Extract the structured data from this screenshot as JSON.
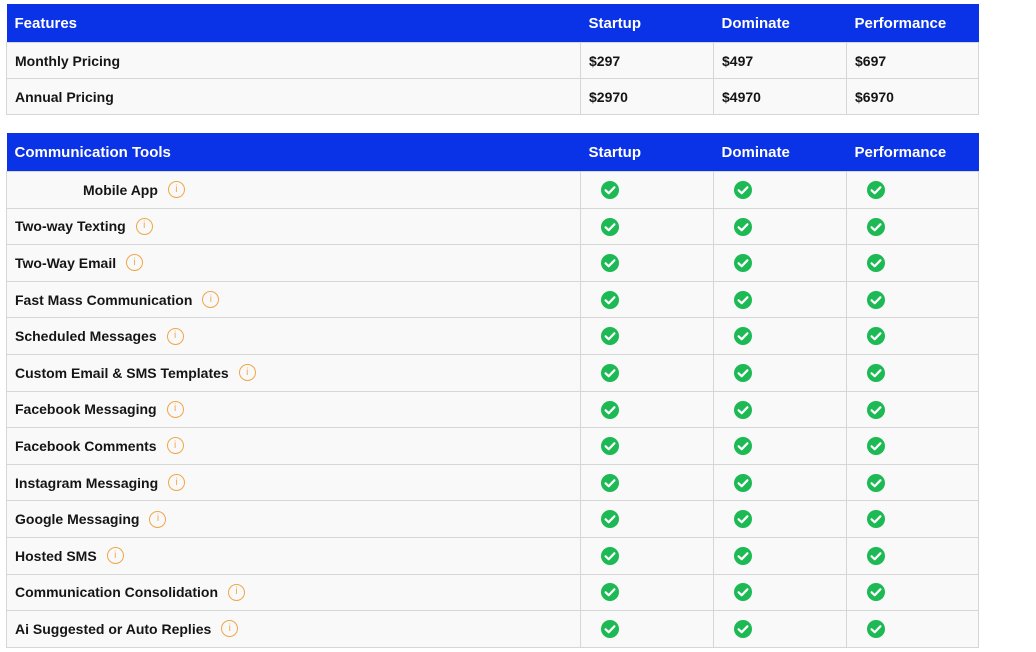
{
  "pricing_table": {
    "headers": [
      "Features",
      "Startup",
      "Dominate",
      "Performance"
    ],
    "rows": [
      {
        "label": "Monthly Pricing",
        "values": [
          "$297",
          "$497",
          "$697"
        ]
      },
      {
        "label": "Annual Pricing",
        "values": [
          "$2970",
          "$4970",
          "$6970"
        ]
      }
    ]
  },
  "communication_table": {
    "headers": [
      "Communication Tools",
      "Startup",
      "Dominate",
      "Performance"
    ],
    "info_glyph": "i",
    "check_color": "#1db954",
    "rows": [
      {
        "label": "Mobile App",
        "included": [
          true,
          true,
          true
        ]
      },
      {
        "label": "Two-way Texting",
        "included": [
          true,
          true,
          true
        ]
      },
      {
        "label": "Two-Way Email",
        "included": [
          true,
          true,
          true
        ]
      },
      {
        "label": "Fast Mass Communication",
        "included": [
          true,
          true,
          true
        ]
      },
      {
        "label": "Scheduled Messages",
        "included": [
          true,
          true,
          true
        ]
      },
      {
        "label": "Custom Email & SMS Templates",
        "included": [
          true,
          true,
          true
        ]
      },
      {
        "label": "Facebook Messaging",
        "included": [
          true,
          true,
          true
        ]
      },
      {
        "label": "Facebook Comments",
        "included": [
          true,
          true,
          true
        ]
      },
      {
        "label": "Instagram Messaging",
        "included": [
          true,
          true,
          true
        ]
      },
      {
        "label": "Google Messaging",
        "included": [
          true,
          true,
          true
        ]
      },
      {
        "label": "Hosted SMS",
        "included": [
          true,
          true,
          true
        ]
      },
      {
        "label": "Communication Consolidation",
        "included": [
          true,
          true,
          true
        ]
      },
      {
        "label": "Ai Suggested or Auto Replies",
        "included": [
          true,
          true,
          true
        ]
      }
    ]
  },
  "colors": {
    "header_bg": "#0a32e6",
    "info_icon": "#f0a64a",
    "check_icon": "#1db954"
  }
}
